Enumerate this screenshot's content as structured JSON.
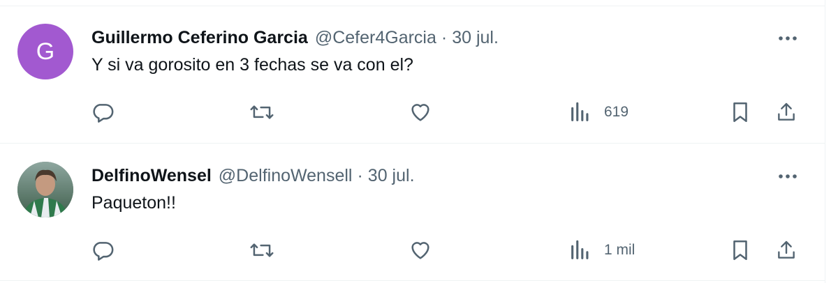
{
  "tweets": [
    {
      "avatar_letter": "G",
      "avatar_color": "#a259d0",
      "name": "Guillermo Ceferino Garcia",
      "handle": "@Cefer4Garcia",
      "separator": "·",
      "date": "30 jul.",
      "text": "Y si va gorosito en 3 fechas se va con el?",
      "views": "619",
      "icons": [
        "reply-icon",
        "retweet-icon",
        "like-icon",
        "views-icon",
        "bookmark-icon",
        "share-icon",
        "more-icon"
      ]
    },
    {
      "avatar_letter": "",
      "name": "DelfinoWensel",
      "handle": "@DelfinoWensell",
      "separator": "·",
      "date": "30 jul.",
      "text": "Paqueton!!",
      "views": "1 mil",
      "icons": [
        "reply-icon",
        "retweet-icon",
        "like-icon",
        "views-icon",
        "bookmark-icon",
        "share-icon",
        "more-icon"
      ]
    }
  ],
  "colors": {
    "text_primary": "#0f1419",
    "text_secondary": "#536471",
    "divider": "#eff3f4"
  }
}
